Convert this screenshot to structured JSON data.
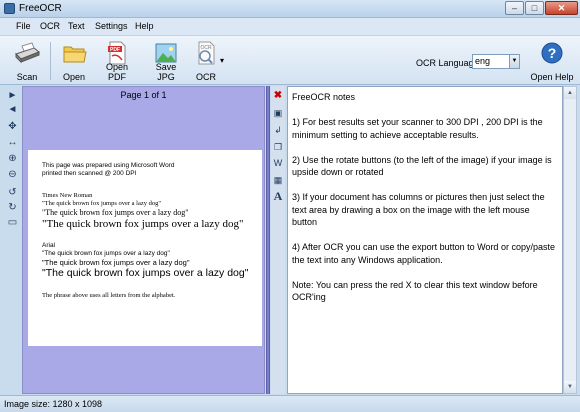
{
  "window": {
    "title": "FreeOCR",
    "minimize_glyph": "–",
    "maximize_glyph": "□",
    "close_glyph": "✕"
  },
  "menu": [
    "File",
    "OCR",
    "Text",
    "Settings",
    "Help"
  ],
  "toolbar": {
    "scan": "Scan",
    "open": "Open",
    "open_pdf": "Open PDF",
    "save_jpg": "Save JPG",
    "ocr": "OCR",
    "ocr_dropdown_glyph": "▾",
    "ocr_language_label": "OCR Language:",
    "ocr_language_value": "eng",
    "dropdown_glyph": "▼",
    "open_help": "Open Help",
    "pdf_badge": "PDF",
    "ocr_badge": "OCR",
    "help_glyph": "?"
  },
  "left_tools": [
    {
      "name": "next-page-icon",
      "glyph": "►"
    },
    {
      "name": "prev-page-icon",
      "glyph": "◄"
    },
    {
      "name": "pan-icon",
      "glyph": "✥"
    },
    {
      "name": "fit-width-icon",
      "glyph": "↔"
    },
    {
      "name": "zoom-in-icon",
      "glyph": "⊕"
    },
    {
      "name": "zoom-out-icon",
      "glyph": "⊖"
    },
    {
      "name": "rotate-left-icon",
      "glyph": "↺"
    },
    {
      "name": "rotate-right-icon",
      "glyph": "↻"
    },
    {
      "name": "select-area-icon",
      "glyph": "▭"
    }
  ],
  "image_pane": {
    "page_label": "Page 1 of 1",
    "doc": {
      "line1": "This page was prepared using Microsoft Word",
      "line2": "printed then scanned @ 200 DPI",
      "tnr_label": "Times New Roman",
      "tnr_small": "\"The quick brown fox jumps over a lazy dog\"",
      "tnr_medium": "\"The quick brown fox jumps over a lazy dog\"",
      "tnr_large": "\"The quick brown fox jumps over a lazy dog\"",
      "arial_label": "Arial",
      "arial_small": "\"The quick brown fox jumps over a lazy dog\"",
      "arial_medium": "\"The quick brown fox  jumps over a lazy dog\"",
      "arial_large": "\"The quick brown fox jumps over a lazy dog\"",
      "footer": "The phrase above uses all letters from the alphabet."
    }
  },
  "mid_tools": [
    {
      "name": "clear-text-icon",
      "glyph": "✖",
      "cls": "mt x"
    },
    {
      "name": "save-text-icon",
      "glyph": "▣",
      "cls": "mt"
    },
    {
      "name": "wrap-text-icon",
      "glyph": "↲",
      "cls": "mt"
    },
    {
      "name": "copy-text-icon",
      "glyph": "❐",
      "cls": "mt"
    },
    {
      "name": "export-word-icon",
      "glyph": "W",
      "cls": "mt"
    },
    {
      "name": "export-icon",
      "glyph": "▦",
      "cls": "mt"
    },
    {
      "name": "font-icon",
      "glyph": "A",
      "cls": "mt"
    }
  ],
  "notes": "FreeOCR notes\n\n1) For best results set your scanner to 300 DPI , 200 DPI is the minimum setting to achieve acceptable results.\n\n2) Use the rotate buttons (to the left of the image) if your image is upside down or rotated\n\n3) If your document has columns or pictures then just select the text area by drawing a box on the image with the left mouse button\n\n4) After OCR you can use the export button to Word or copy/paste the text into any Windows application.\n\nNote: You can press the red X to clear this text window before OCR'ing",
  "scrollbar": {
    "up_glyph": "▲",
    "down_glyph": "▼"
  },
  "status": "Image size:  1280 x 1098"
}
